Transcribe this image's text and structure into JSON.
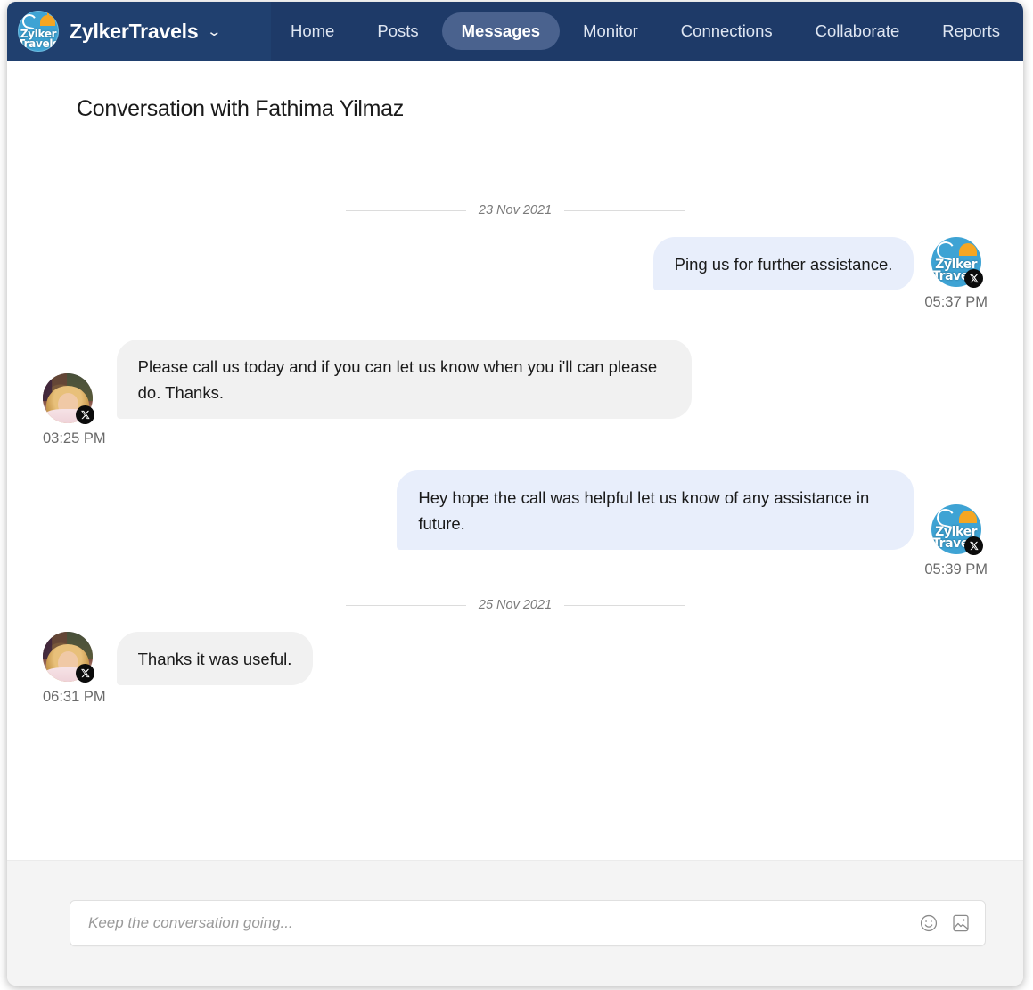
{
  "topbar": {
    "brand": {
      "name": "ZylkerTravels",
      "logo_line1": "Zylker",
      "logo_line2": "Travels",
      "caret": "⌄"
    },
    "nav_items": [
      {
        "label": "Home",
        "active": false
      },
      {
        "label": "Posts",
        "active": false
      },
      {
        "label": "Messages",
        "active": true
      },
      {
        "label": "Monitor",
        "active": false
      },
      {
        "label": "Connections",
        "active": false
      },
      {
        "label": "Collaborate",
        "active": false
      },
      {
        "label": "Reports",
        "active": false
      }
    ],
    "colors": {
      "background": "#1e3a68",
      "active_pill": "#4a628e",
      "text": "#dfe6f2"
    }
  },
  "conversation": {
    "title": "Conversation with Fathima Yilmaz",
    "contact_name": "Fathima Yilmaz",
    "channel": "x-twitter"
  },
  "thread": {
    "groups": [
      {
        "date": "23 Nov 2021",
        "messages": [
          {
            "direction": "out",
            "text": "Ping us for further assistance.",
            "time": "05:37 PM",
            "avatar": "brand"
          },
          {
            "direction": "in",
            "text": "Please call us today and if you can let us know when you i'll can please do. Thanks.",
            "time": "03:25 PM",
            "avatar": "photo"
          },
          {
            "direction": "out",
            "text": "Hey hope the call was helpful let us know of any assistance in future.",
            "time": "05:39 PM",
            "avatar": "brand"
          }
        ]
      },
      {
        "date": "25 Nov 2021",
        "messages": [
          {
            "direction": "in",
            "text": "Thanks it was useful.",
            "time": "06:31 PM",
            "avatar": "photo"
          }
        ]
      }
    ],
    "colors": {
      "outgoing_bubble": "#e8eefb",
      "incoming_bubble": "#f1f1f1",
      "timestamp": "#6a6a6a",
      "date_label": "#7a7a7a"
    }
  },
  "composer": {
    "placeholder": "Keep the conversation going...",
    "value": "",
    "emoji_icon": "smiley-icon",
    "image_icon": "image-icon",
    "background": "#f4f4f4"
  }
}
